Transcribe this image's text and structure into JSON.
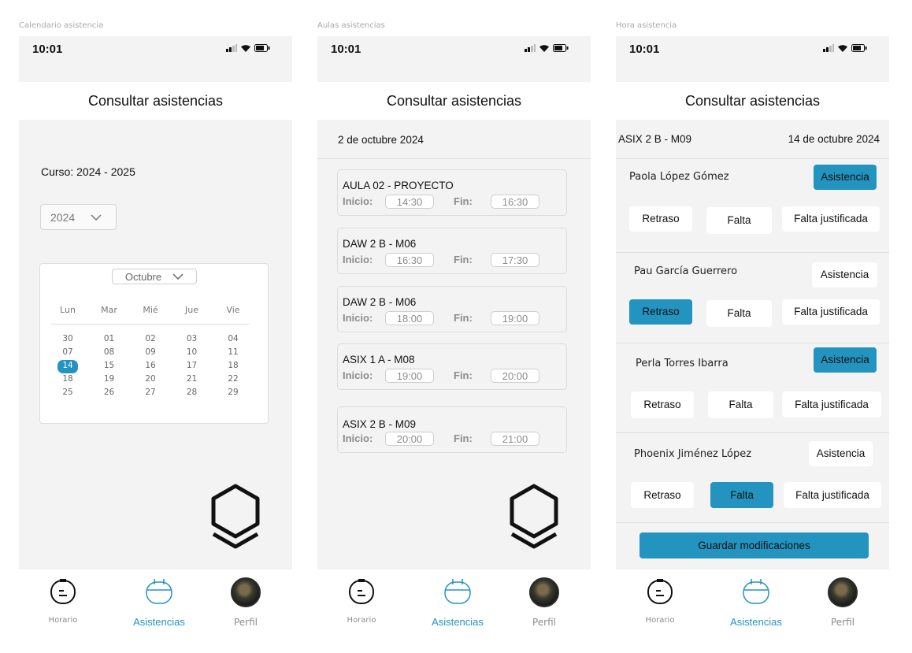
{
  "frames": [
    {
      "label": "Calendario asistencia"
    },
    {
      "label": "Aulas asistencias"
    },
    {
      "label": "Hora asistencia"
    }
  ],
  "status": {
    "time": "10:01"
  },
  "header": {
    "title": "Consultar asistencias"
  },
  "tabbar": {
    "horario": "Horario",
    "asistencias": "Asistencias",
    "perfil": "Perfil"
  },
  "calendar": {
    "curso": "Curso: 2024 - 2025",
    "year": "2024",
    "month": "Octubre",
    "weekdays": [
      "Lun",
      "Mar",
      "Mié",
      "Jue",
      "Vie"
    ],
    "weeks": [
      [
        "30",
        "01",
        "02",
        "03",
        "04"
      ],
      [
        "07",
        "08",
        "09",
        "10",
        "11"
      ],
      [
        "14",
        "15",
        "16",
        "17",
        "18"
      ],
      [
        "18",
        "19",
        "20",
        "21",
        "22"
      ],
      [
        "25",
        "26",
        "27",
        "28",
        "29"
      ]
    ],
    "selected_day": "14"
  },
  "aulas": {
    "date": "2 de octubre 2024",
    "inicio_label": "Inicio:",
    "fin_label": "Fin:",
    "sessions": [
      {
        "name": "AULA 02 - PROYECTO",
        "start": "14:30",
        "end": "16:30"
      },
      {
        "name": "DAW 2 B - M06",
        "start": "16:30",
        "end": "17:30"
      },
      {
        "name": "DAW 2 B - M06",
        "start": "18:00",
        "end": "19:00"
      },
      {
        "name": "ASIX 1 A - M08",
        "start": "19:00",
        "end": "20:00"
      },
      {
        "name": "ASIX 2 B - M09",
        "start": "20:00",
        "end": "21:00"
      }
    ]
  },
  "hora": {
    "group": "ASIX 2 B - M09",
    "date": "14 de octubre 2024",
    "labels": {
      "asistencia": "Asistencia",
      "retraso": "Retraso",
      "falta": "Falta",
      "falta_justificada": "Falta justificada"
    },
    "students": [
      {
        "name": "Paola López Gómez",
        "selected": "asistencia"
      },
      {
        "name": "Pau García Guerrero",
        "selected": "retraso"
      },
      {
        "name": "Perla Torres Ibarra",
        "selected": "asistencia"
      },
      {
        "name": "Phoenix  Jiménez López",
        "selected": "falta"
      }
    ],
    "save": "Guardar modificaciones"
  },
  "colors": {
    "accent": "#2394c0",
    "background": "#f3f3f3"
  }
}
